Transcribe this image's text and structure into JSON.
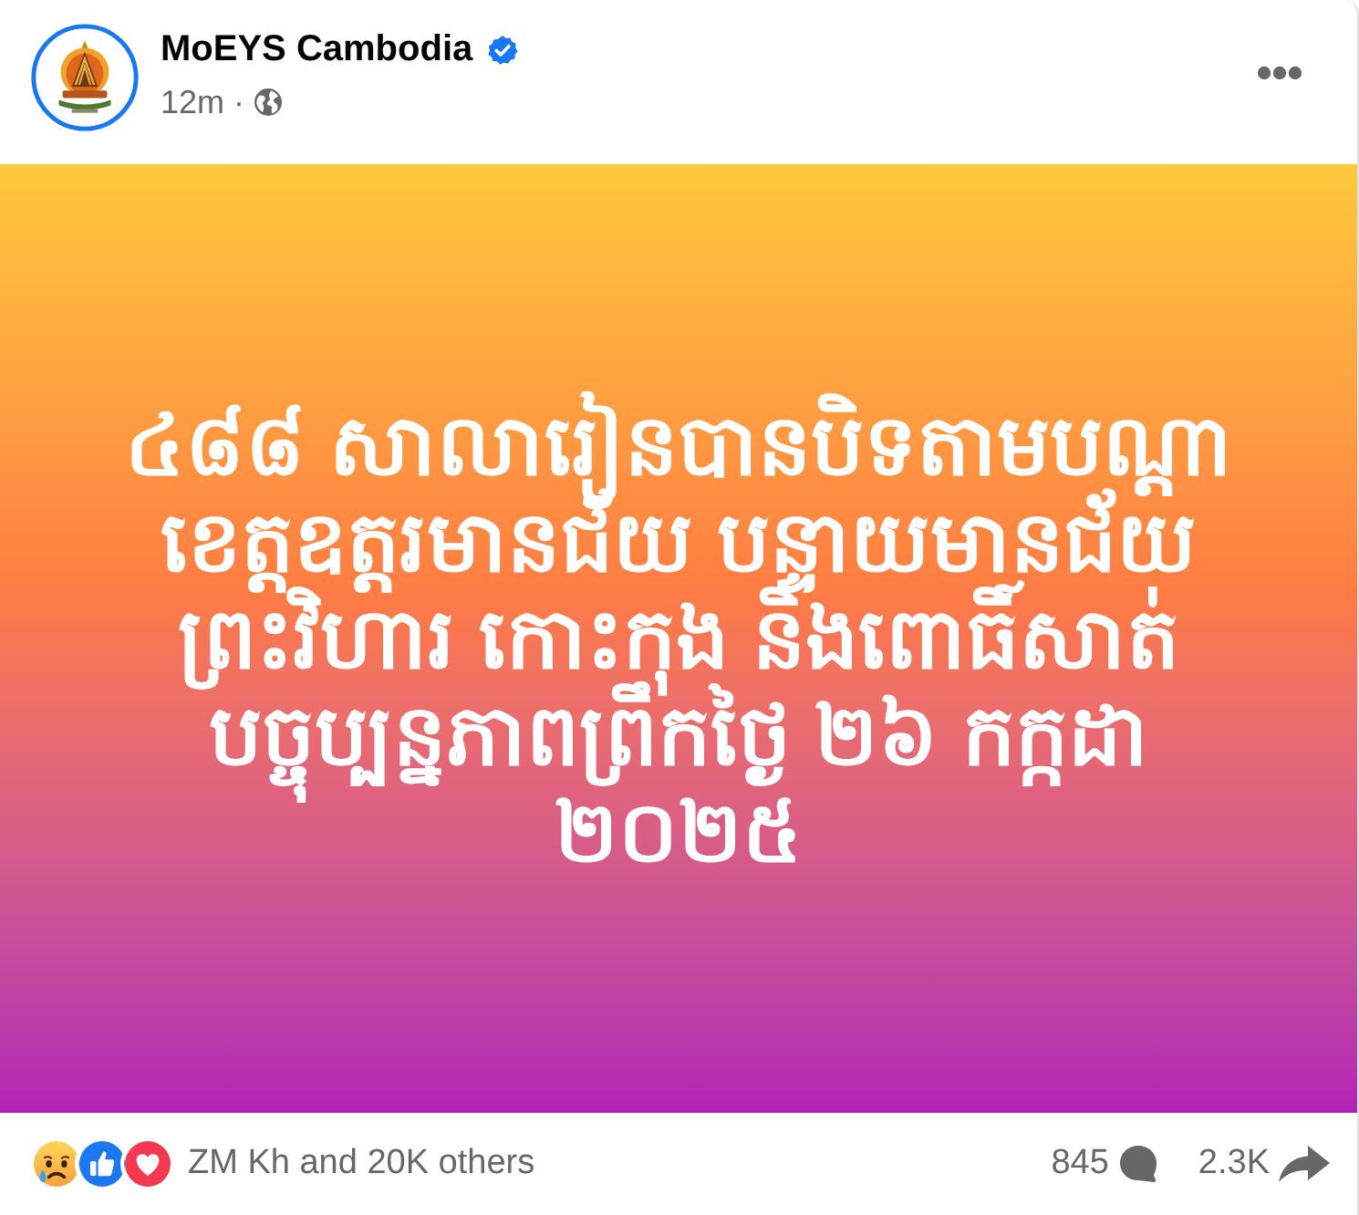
{
  "header": {
    "author": "MoEYS Cambodia",
    "verified": true,
    "time": "12m",
    "separator": "·"
  },
  "text_post": {
    "text": "៤៨៨ សាលារៀនបានបិទតាមបណ្ដា\nខេត្តឧត្តរមានជ័យ បន្ទាយមានជ័យ\nព្រះវិហារ កោះកុង និងពោធិ៍សាត់\nបច្ចុប្បន្នភាពព្រឹកថ្ងៃ ២៦ កក្កដា\n២០២៥"
  },
  "footer": {
    "reactions": [
      {
        "kind": "sad"
      },
      {
        "kind": "like"
      },
      {
        "kind": "love"
      }
    ],
    "reaction_summary": "ZM Kh and 20K others",
    "comment_count": "845",
    "share_count": "2.3K"
  }
}
